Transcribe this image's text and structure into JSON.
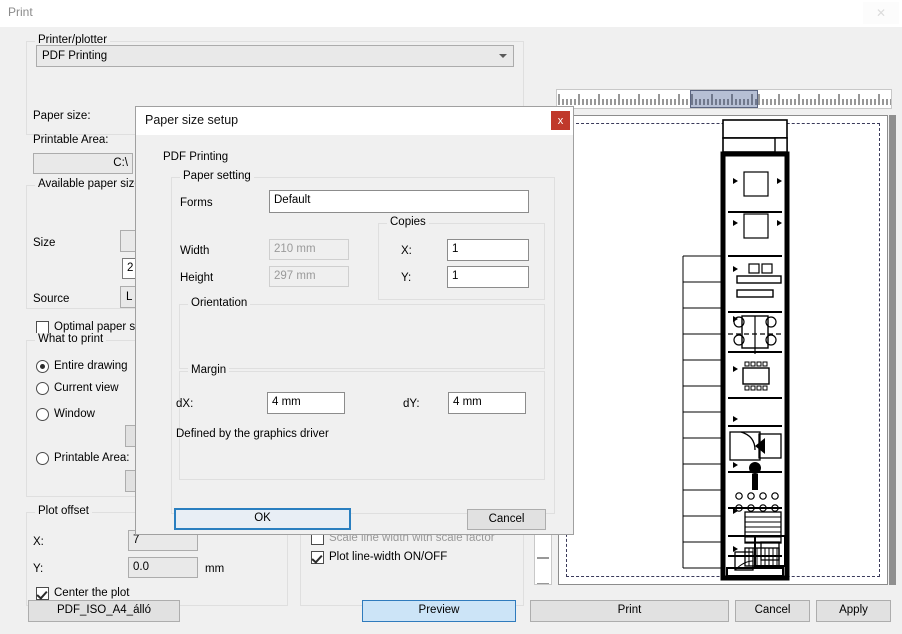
{
  "window": {
    "title": "Print",
    "close_label": "✕"
  },
  "printer_group": {
    "legend": "Printer/plotter",
    "selected": "PDF Printing"
  },
  "paper": {
    "paper_size_label": "Paper size:",
    "printable_area_label": "Printable Area:",
    "printable_area_value": "C:\\"
  },
  "available_sizes": {
    "legend": "Available paper sizes",
    "size_label": "Size",
    "size_value": "2",
    "source_label": "Source",
    "source_value": "L",
    "optimal_label": "Optimal paper size",
    "optimal_checked": false
  },
  "what_to_print": {
    "legend": "What to print",
    "options": [
      {
        "label": "Entire drawing",
        "selected": true
      },
      {
        "label": "Current view",
        "selected": false
      },
      {
        "label": "Window",
        "selected": false
      },
      {
        "label": "Printable Area:",
        "selected": false
      }
    ]
  },
  "plot_offset": {
    "legend": "Plot offset",
    "x_label": "X:",
    "x_value": "7",
    "y_label": "Y:",
    "y_value": "0.0",
    "unit": "mm",
    "center_label": "Center the plot",
    "center_checked": true
  },
  "plot_options": {
    "scale_line_width_label": "Scale line width with scale factor",
    "scale_line_width_checked": false,
    "plot_line_width_label": "Plot line-width ON/OFF",
    "plot_line_width_checked": true
  },
  "footer": {
    "preset_button": "PDF_ISO_A4_álló",
    "preview_button": "Preview",
    "print_button": "Print",
    "cancel_button": "Cancel",
    "apply_button": "Apply"
  },
  "modal": {
    "title": "Paper size setup",
    "close_label": "x",
    "device_name": "PDF Printing",
    "paper_setting": {
      "legend": "Paper setting",
      "forms_label": "Forms",
      "forms_value": "Default",
      "width_label": "Width",
      "width_value": "210 mm",
      "height_label": "Height",
      "height_value": "297 mm"
    },
    "copies": {
      "legend": "Copies",
      "x_label": "X:",
      "x_value": "1",
      "y_label": "Y:",
      "y_value": "1"
    },
    "orientation": {
      "legend": "Orientation"
    },
    "margin": {
      "legend": "Margin",
      "dx_label": "dX:",
      "dx_value": "4 mm",
      "dy_label": "dY:",
      "dy_value": "4 mm",
      "note": "Defined by the graphics driver"
    },
    "ok_button": "OK",
    "cancel_button": "Cancel"
  },
  "colors": {
    "accent": "#2a7fc0",
    "primary_fill": "#cce4f7",
    "close_red": "#c0392b",
    "panel": "#f0f0f0"
  }
}
